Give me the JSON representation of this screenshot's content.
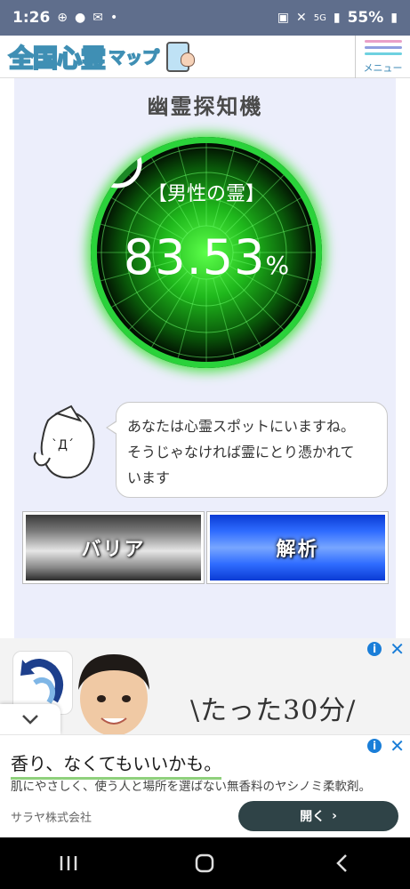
{
  "status_bar": {
    "time": "1:26",
    "network": "5G",
    "battery": "55%"
  },
  "header": {
    "logo_text": "全国心霊",
    "logo_kana": "マップ",
    "menu_label": "メニュー",
    "menu_colors": [
      "#e9a0c8",
      "#8f9ee0",
      "#6ed1e0"
    ]
  },
  "main": {
    "title": "幽霊探知機",
    "radar": {
      "spirit_type": "【男性の霊】",
      "value": "83.53",
      "unit": "%",
      "glow_color": "#3ee63a"
    },
    "message": {
      "line1": "あなたは心霊スポットにいますね。",
      "line2": "そうじゃなければ霊にとり憑かれて",
      "line3": "います"
    },
    "buttons": {
      "barrier": "バリア",
      "analyze": "解析"
    }
  },
  "ad_top": {
    "slogan": "\\たった30分/"
  },
  "ad_bottom": {
    "headline": "香り、なくてもいいかも。",
    "description": "肌にやさしく、使う人と場所を選ばない無香料のヤシノミ柔軟剤。",
    "company": "サラヤ株式会社",
    "cta": "開く"
  },
  "nav": {
    "icons": [
      "recent-apps-icon",
      "home-icon",
      "back-icon"
    ]
  }
}
